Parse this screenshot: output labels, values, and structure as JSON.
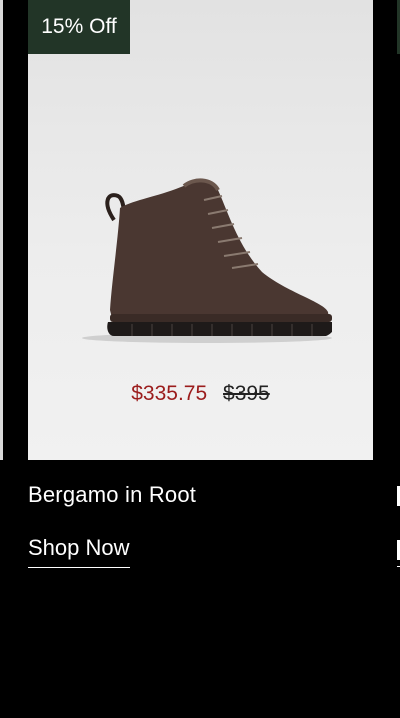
{
  "product": {
    "badge": "15% Off",
    "sale_price": "$335.75",
    "original_price": "$395",
    "name": "Bergamo in Root",
    "cta_label": "Shop Now",
    "image_icon": "suede-lace-up-boot"
  },
  "colors": {
    "badge_bg": "#223527",
    "sale_price": "#9b1c1c",
    "page_bg": "#000000",
    "card_bg": "#ececec"
  }
}
